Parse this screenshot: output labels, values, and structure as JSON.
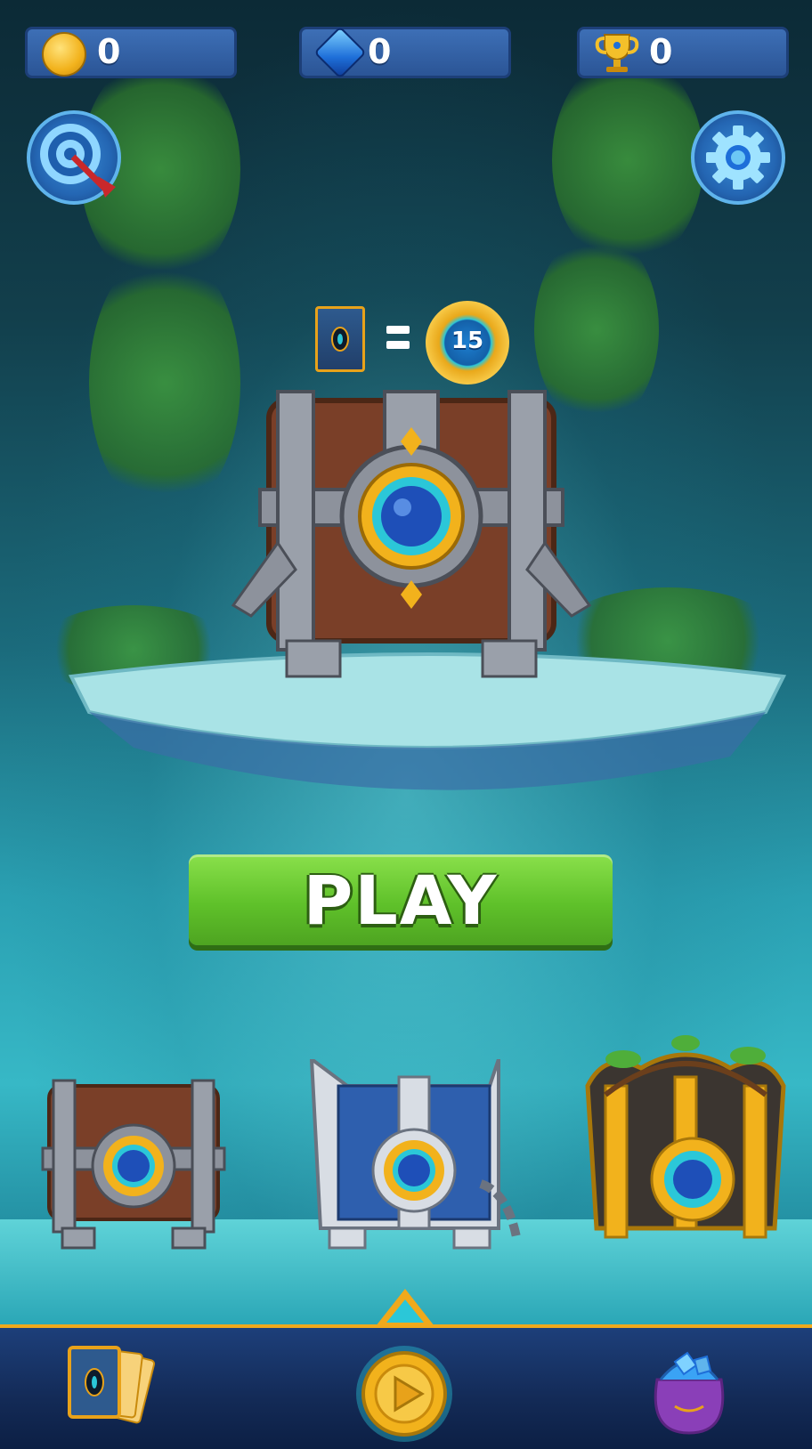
{
  "hud": {
    "coins": {
      "value": "0",
      "icon": "coin-icon"
    },
    "gems": {
      "value": "0",
      "icon": "gem-icon"
    },
    "trophies": {
      "value": "0",
      "icon": "trophy-icon"
    }
  },
  "buttons": {
    "missions": {
      "icon": "target-icon"
    },
    "settings": {
      "icon": "gear-icon"
    },
    "play_label": "PLAY"
  },
  "exchange": {
    "card_icon": "card-icon",
    "equals_icon": "equals-icon",
    "badge_value": "15"
  },
  "chests": [
    {
      "name": "wooden-chest"
    },
    {
      "name": "silver-chest"
    },
    {
      "name": "golden-chest"
    }
  ],
  "bottom_nav": [
    {
      "name": "cards",
      "icon": "cards-icon"
    },
    {
      "name": "play",
      "icon": "play-icon"
    },
    {
      "name": "gem-bag",
      "icon": "gem-bag-icon"
    }
  ],
  "colors": {
    "play_green": "#5fc12a",
    "hud_blue": "#2b5596",
    "gold": "#f2b21c",
    "nav_bar": "#132a56"
  }
}
